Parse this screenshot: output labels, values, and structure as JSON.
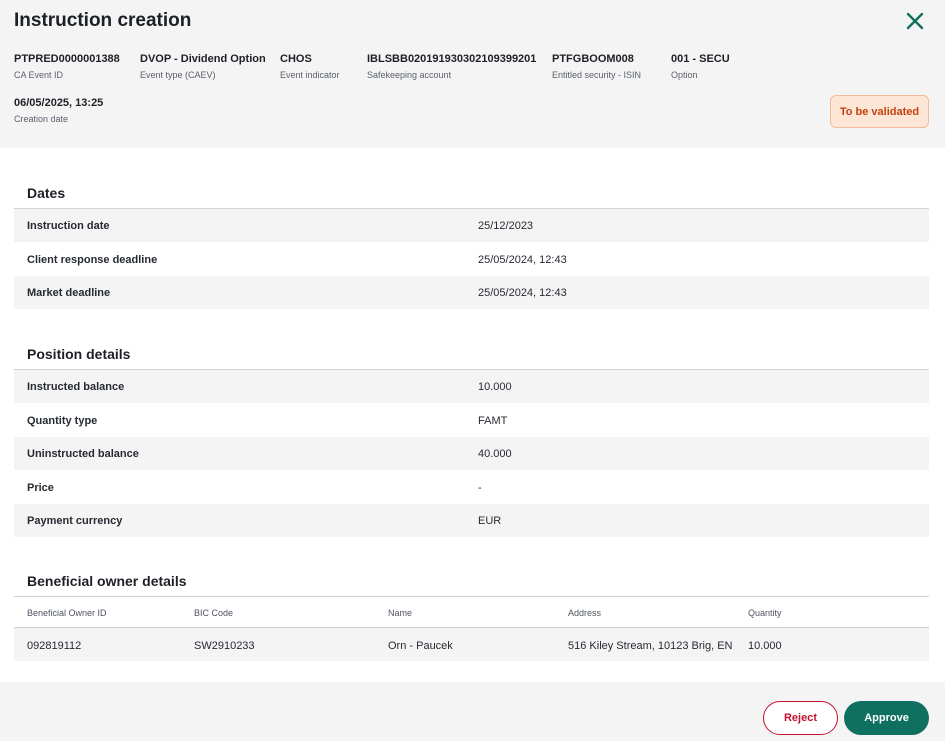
{
  "header": {
    "title": "Instruction creation",
    "meta": [
      {
        "value": "PTPRED0000001388",
        "label": "CA Event ID"
      },
      {
        "value": "DVOP - Dividend Option",
        "label": "Event type (CAEV)"
      },
      {
        "value": "CHOS",
        "label": "Event indicator"
      },
      {
        "value": "IBLSBB020191930302109399201",
        "label": "Safekeeping account"
      },
      {
        "value": "PTFGBOOM008",
        "label": "Entitled security - ISIN"
      },
      {
        "value": "001 - SECU",
        "label": "Option"
      },
      {
        "value": "06/05/2025, 13:25",
        "label": "Creation date"
      }
    ],
    "status": "To be validated"
  },
  "dates": {
    "title": "Dates",
    "rows": [
      {
        "label": "Instruction date",
        "value": "25/12/2023"
      },
      {
        "label": "Client response deadline",
        "value": "25/05/2024, 12:43"
      },
      {
        "label": "Market deadline",
        "value": "25/05/2024, 12:43"
      }
    ]
  },
  "position": {
    "title": "Position details",
    "rows": [
      {
        "label": "Instructed balance",
        "value": "10.000"
      },
      {
        "label": "Quantity type",
        "value": "FAMT"
      },
      {
        "label": "Uninstructed balance",
        "value": "40.000"
      },
      {
        "label": "Price",
        "value": "-"
      },
      {
        "label": "Payment currency",
        "value": "EUR"
      }
    ]
  },
  "beneficial": {
    "title": "Beneficial owner details",
    "columns": [
      "Beneficial Owner ID",
      "BIC Code",
      "Name",
      "Address",
      "Quantity"
    ],
    "rows": [
      [
        "092819112",
        "SW2910233",
        "Orn - Paucek",
        "516 Kiley Stream, 10123 Brig, EN",
        "10.000"
      ]
    ]
  },
  "actions": {
    "reject": "Reject",
    "approve": "Approve"
  },
  "colors": {
    "accent": "#10705f",
    "danger": "#c8102e",
    "status_bg": "#fde6d6",
    "status_text": "#c2410c"
  }
}
